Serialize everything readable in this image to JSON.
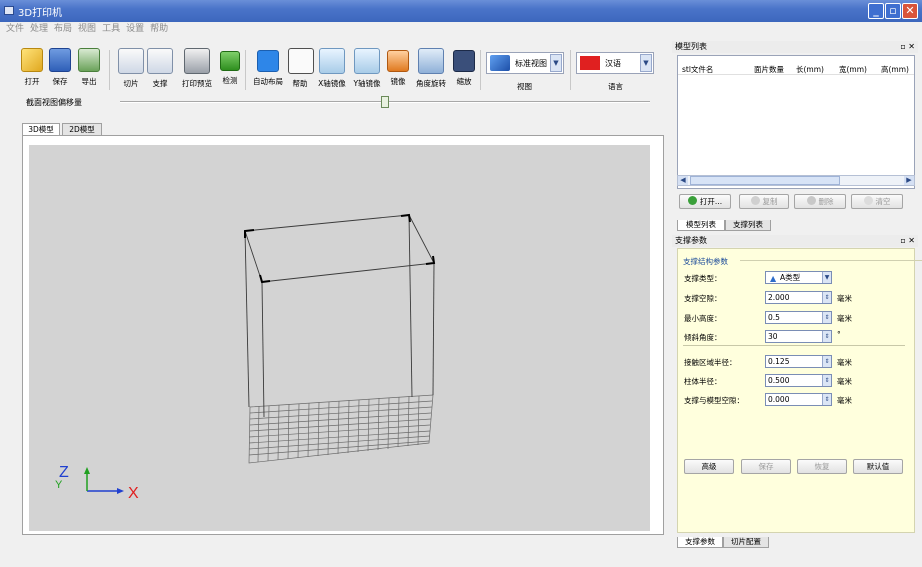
{
  "window": {
    "title": "3D打印机"
  },
  "menu": [
    "文件",
    "处理",
    "布局",
    "视图",
    "工具",
    "设置",
    "帮助"
  ],
  "toolbar": {
    "open": "打开",
    "save": "保存",
    "export": "导出",
    "slice": "切片",
    "support": "支撑",
    "print_preview": "打印预览",
    "check": "检测",
    "auto_layout": "自动布局",
    "help": "帮助",
    "x_mirror": "X轴镜像",
    "y_mirror": "Y轴镜像",
    "mirror": "镜像",
    "angle_rotate": "角度旋转",
    "scale": "缩放",
    "view_combo_value": "标准视图",
    "view_label": "视图",
    "lang_combo_value": "汉语",
    "lang_label": "语言"
  },
  "slider": {
    "label": "截面视图偏移量"
  },
  "tabs": [
    "3D模型",
    "2D模型"
  ],
  "model_list": {
    "title": "模型列表",
    "columns": [
      "stl文件名",
      "面片数量",
      "长(mm)",
      "宽(mm)",
      "高(mm)"
    ],
    "buttons": {
      "open": "打开...",
      "copy": "复制",
      "delete": "删除",
      "clear": "清空"
    },
    "bottom_tabs": [
      "模型列表",
      "支撑列表"
    ]
  },
  "support_params": {
    "title": "支撑参数",
    "group_title": "支撑结构参数",
    "support_type_label": "支撑类型：",
    "support_type_value": "A类型",
    "spacing_label": "支撑空隙：",
    "spacing_value": "2.000",
    "spacing_unit": "毫米",
    "min_height_label": "最小高度：",
    "min_height_value": "0.5",
    "min_height_unit": "毫米",
    "tilt_angle_label": "倾斜角度：",
    "tilt_angle_value": "30",
    "tilt_angle_unit": "°",
    "contact_radius_label": "接触区域半径：",
    "contact_radius_value": "0.125",
    "contact_radius_unit": "毫米",
    "column_radius_label": "柱体半径：",
    "column_radius_value": "0.500",
    "column_radius_unit": "毫米",
    "gap_label": "支撑与模型空隙：",
    "gap_value": "0.000",
    "gap_unit": "毫米",
    "buttons": {
      "advanced": "高级",
      "save": "保存",
      "restore": "恢复",
      "default": "默认值"
    },
    "bottom_tabs": [
      "支撑参数",
      "切片配置"
    ]
  },
  "axes": {
    "x": "X",
    "y": "Y",
    "z": "Z"
  },
  "colors": {
    "title_bar": "#4a74c9",
    "viewport_bg": "#d3d3d3",
    "params_bg": "#ffffdd",
    "axis_x": "#e02020",
    "axis_y": "#20a020",
    "axis_z": "#2040d0"
  }
}
